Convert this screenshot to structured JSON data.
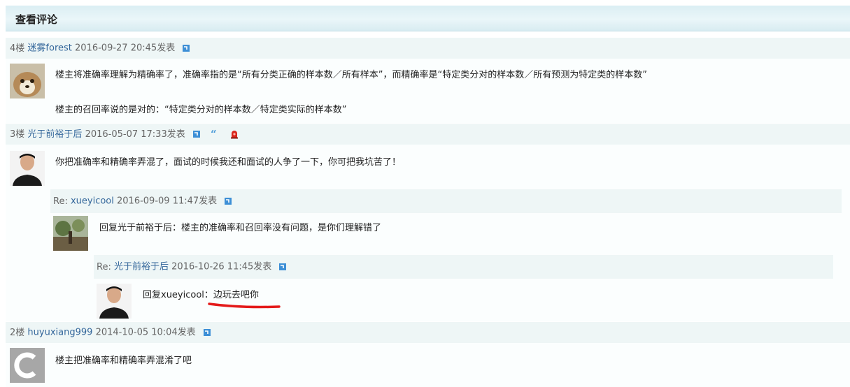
{
  "header": {
    "title": "查看评论"
  },
  "comments": [
    {
      "floor": "4楼",
      "user": "迷雾forest",
      "datetime": "2016-09-27 20:45",
      "posted": "发表",
      "lines": [
        "楼主将准确率理解为精确率了，准确率指的是“所有分类正确的样本数／所有样本”，而精确率是“特定类分对的样本数／所有预测为特定类的样本数”",
        "楼主的召回率说的是对的：“特定类分对的样本数／特定类实际的样本数”"
      ]
    },
    {
      "floor": "3楼",
      "user": "光于前裕于后",
      "datetime": "2016-05-07 17:33",
      "posted": "发表",
      "lines": [
        "你把准确率和精确率弄混了，面试的时候我还和面试的人争了一下，你可把我坑苦了！"
      ],
      "replies": [
        {
          "prefix": "Re: ",
          "user": "xueyicool",
          "datetime": "2016-09-09 11:47",
          "posted": "发表",
          "text": "回复光于前裕于后：楼主的准确率和召回率没有问题，是你们理解错了",
          "replies": [
            {
              "prefix": "Re: ",
              "user": "光于前裕于后",
              "datetime": "2016-10-26 11:45",
              "posted": "发表",
              "text_prefix": "回复xueyicool：",
              "text_highlight": "边玩去吧你"
            }
          ]
        }
      ]
    },
    {
      "floor": "2楼",
      "user": "huyuxiang999",
      "datetime": "2014-10-05 10:04",
      "posted": "发表",
      "lines": [
        "楼主把准确率和精确率弄混淆了吧"
      ]
    }
  ],
  "colors": {
    "username": "#34679b",
    "bar_bg": "#eef6f6",
    "annotation_red": "#e41a1a"
  },
  "icons": [
    "reply-icon",
    "quote-icon",
    "report-icon"
  ]
}
